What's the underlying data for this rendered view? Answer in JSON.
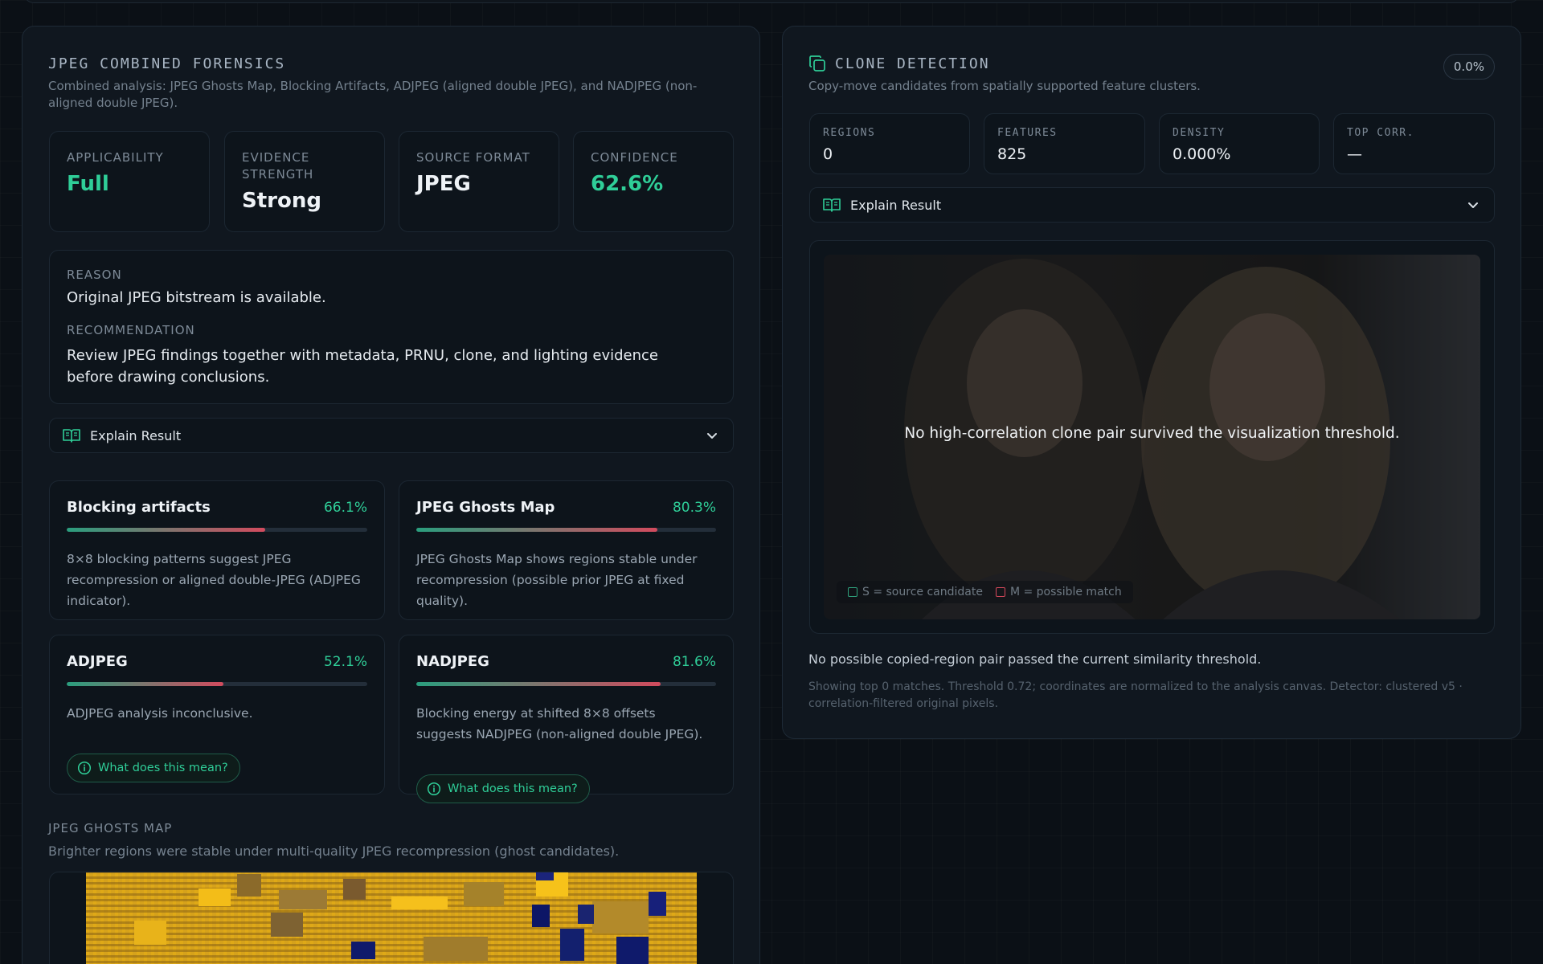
{
  "jpeg_panel": {
    "title": "JPEG COMBINED FORENSICS",
    "subtitle": "Combined analysis: JPEG Ghosts Map, Blocking Artifacts, ADJPEG (aligned double JPEG), and NADJPEG (non-aligned double JPEG).",
    "stats": [
      {
        "label": "APPLICABILITY",
        "value": "Full"
      },
      {
        "label": "EVIDENCE STRENGTH",
        "value": "Strong"
      },
      {
        "label": "SOURCE FORMAT",
        "value": "JPEG"
      },
      {
        "label": "CONFIDENCE",
        "value": "62.6%"
      }
    ],
    "reason_label": "REASON",
    "reason_text": "Original JPEG bitstream is available.",
    "recommendation_label": "RECOMMENDATION",
    "recommendation_text": "Review JPEG findings together with metadata, PRNU, clone, and lighting evidence before drawing conclusions.",
    "explain_label": "Explain Result",
    "metrics": [
      {
        "name": "Blocking artifacts",
        "pct": "66.1%",
        "value": 66.1,
        "desc": "8×8 blocking patterns suggest JPEG recompression or aligned double-JPEG (ADJPEG indicator)."
      },
      {
        "name": "JPEG Ghosts Map",
        "pct": "80.3%",
        "value": 80.3,
        "desc": "JPEG Ghosts Map shows regions stable under recompression (possible prior JPEG at fixed quality)."
      },
      {
        "name": "ADJPEG",
        "pct": "52.1%",
        "value": 52.1,
        "desc": "ADJPEG analysis inconclusive.",
        "help": "What does this mean?"
      },
      {
        "name": "NADJPEG",
        "pct": "81.6%",
        "value": 81.6,
        "desc": "Blocking energy at shifted 8×8 offsets suggests NADJPEG (non-aligned double JPEG).",
        "help": "What does this mean?"
      }
    ],
    "ghost_title": "JPEG GHOSTS MAP",
    "ghost_subtitle": "Brighter regions were stable under multi-quality JPEG recompression (ghost candidates)."
  },
  "clone_panel": {
    "title": "CLONE DETECTION",
    "subtitle": "Copy-move candidates from spatially supported feature clusters.",
    "chip": "0.0%",
    "stats": [
      {
        "label": "REGIONS",
        "value": "0"
      },
      {
        "label": "FEATURES",
        "value": "825"
      },
      {
        "label": "DENSITY",
        "value": "0.000%"
      },
      {
        "label": "TOP CORR.",
        "value": "—"
      }
    ],
    "explain_label": "Explain Result",
    "overlay_message": "No high-correlation clone pair survived the visualization threshold.",
    "legend_source": "S = source candidate",
    "legend_match": "M = possible match",
    "result_text": "No possible copied-region pair passed the current similarity threshold.",
    "footnote": "Showing top 0 matches. Threshold 0.72; coordinates are normalized to the analysis canvas. Detector: clustered v5 · correlation-filtered original pixels."
  },
  "colors": {
    "accent_green": "#2fce98",
    "bar_start": "#2a9e7e",
    "bar_end": "#d24b5e",
    "source_legend": "#2fa07c",
    "match_legend": "#d2485a"
  },
  "icons": [
    "copy-icon",
    "book-icon",
    "chevron-down-icon",
    "info-icon"
  ]
}
